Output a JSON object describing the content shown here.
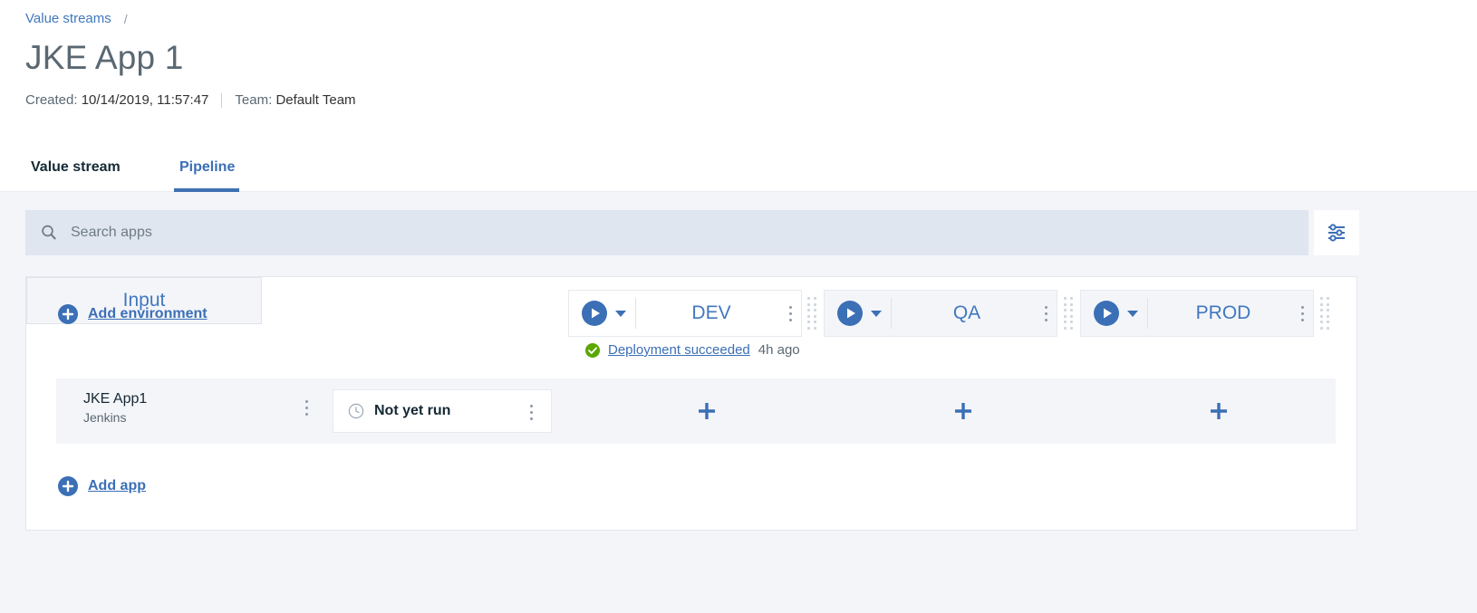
{
  "breadcrumb": {
    "parent": "Value streams",
    "separator": "/"
  },
  "header": {
    "title": "JKE App 1",
    "created_label": "Created:",
    "created_value": "10/14/2019, 11:57:47",
    "team_label": "Team:",
    "team_value": "Default Team"
  },
  "tabs": [
    {
      "label": "Value stream",
      "active": false
    },
    {
      "label": "Pipeline",
      "active": true
    }
  ],
  "search": {
    "placeholder": "Search apps",
    "value": "",
    "icon": "search-icon",
    "filter_icon": "filter-sliders-icon"
  },
  "pipeline": {
    "add_environment_label": "Add environment",
    "add_app_label": "Add app",
    "input_stage_label": "Input",
    "environments": [
      {
        "name": "DEV",
        "play_icon": "play-circle-icon",
        "menu_icon": "kebab-menu-icon",
        "drag_icon": "drag-handle-icon"
      },
      {
        "name": "QA",
        "play_icon": "play-circle-icon",
        "menu_icon": "kebab-menu-icon",
        "drag_icon": "drag-handle-icon"
      },
      {
        "name": "PROD",
        "play_icon": "play-circle-icon",
        "menu_icon": "kebab-menu-icon",
        "drag_icon": "drag-handle-icon"
      }
    ],
    "deployment": {
      "status_icon": "check-circle-icon",
      "status_link": "Deployment succeeded",
      "time_ago": "4h ago"
    },
    "apps": [
      {
        "name": "JKE App1",
        "provider": "Jenkins",
        "input_status": "Not yet run",
        "input_status_icon": "clock-icon",
        "menu_icon": "kebab-menu-icon",
        "add_icon": "plus-icon"
      }
    ]
  },
  "colors": {
    "accent": "#3b6fb6",
    "link": "#4178be",
    "title": "#5a6872",
    "page_bg": "#f4f5f9",
    "search_bg": "#dfe6ef",
    "success": "#5aa700"
  }
}
